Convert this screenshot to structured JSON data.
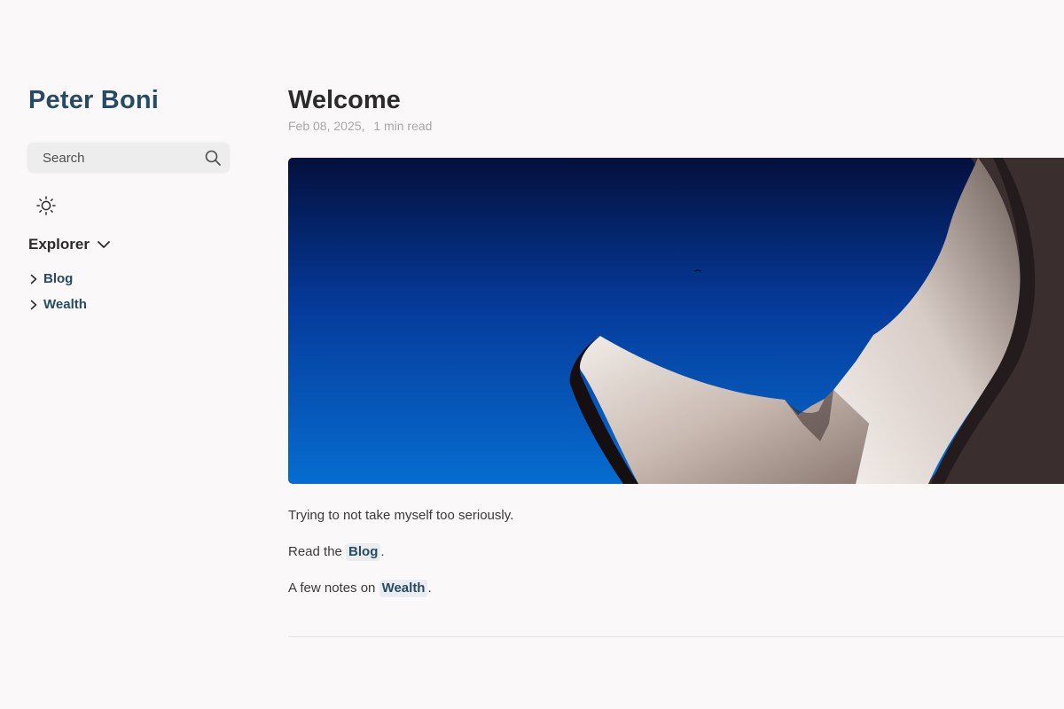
{
  "sidebar": {
    "site_title": "Peter Boni",
    "search": {
      "label": "Search",
      "icon": "search-icon"
    },
    "theme_toggle_icon": "sun-icon",
    "explorer": {
      "title": "Explorer",
      "items": [
        {
          "label": "Blog",
          "icon": "chevron-right-icon"
        },
        {
          "label": "Wealth",
          "icon": "chevron-right-icon"
        }
      ]
    }
  },
  "article": {
    "title": "Welcome",
    "date": "Feb 08, 2025",
    "separator": ",",
    "read_time": "1 min read",
    "paragraphs": {
      "p1": "Trying to not take myself too seriously.",
      "p2_prefix": "Read the ",
      "p2_link": "Blog",
      "p2_suffix": ".",
      "p3_prefix": "A few notes on ",
      "p3_link": "Wealth",
      "p3_suffix": "."
    }
  },
  "colors": {
    "brand": "#284b63",
    "background": "#faf8f8",
    "link_bg": "#eaedf0",
    "muted": "#a8a8a8"
  }
}
